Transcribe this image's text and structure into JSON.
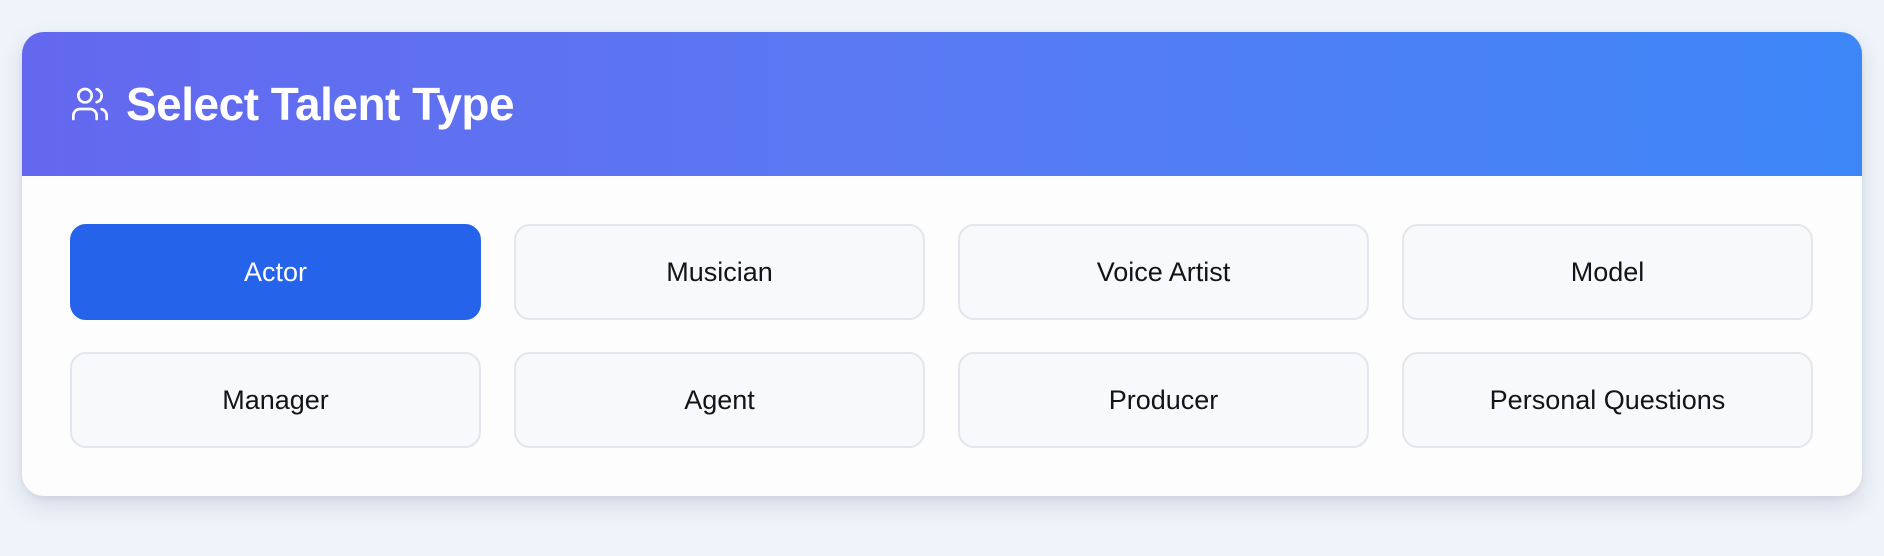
{
  "header": {
    "title": "Select Talent Type",
    "icon": "users-icon"
  },
  "options": [
    {
      "label": "Actor",
      "selected": true
    },
    {
      "label": "Musician",
      "selected": false
    },
    {
      "label": "Voice Artist",
      "selected": false
    },
    {
      "label": "Model",
      "selected": false
    },
    {
      "label": "Manager",
      "selected": false
    },
    {
      "label": "Agent",
      "selected": false
    },
    {
      "label": "Producer",
      "selected": false
    },
    {
      "label": "Personal Questions",
      "selected": false
    }
  ],
  "colors": {
    "accent": "#2563eb",
    "header_gradient_start": "#6468ef",
    "header_gradient_end": "#3c86f8"
  }
}
